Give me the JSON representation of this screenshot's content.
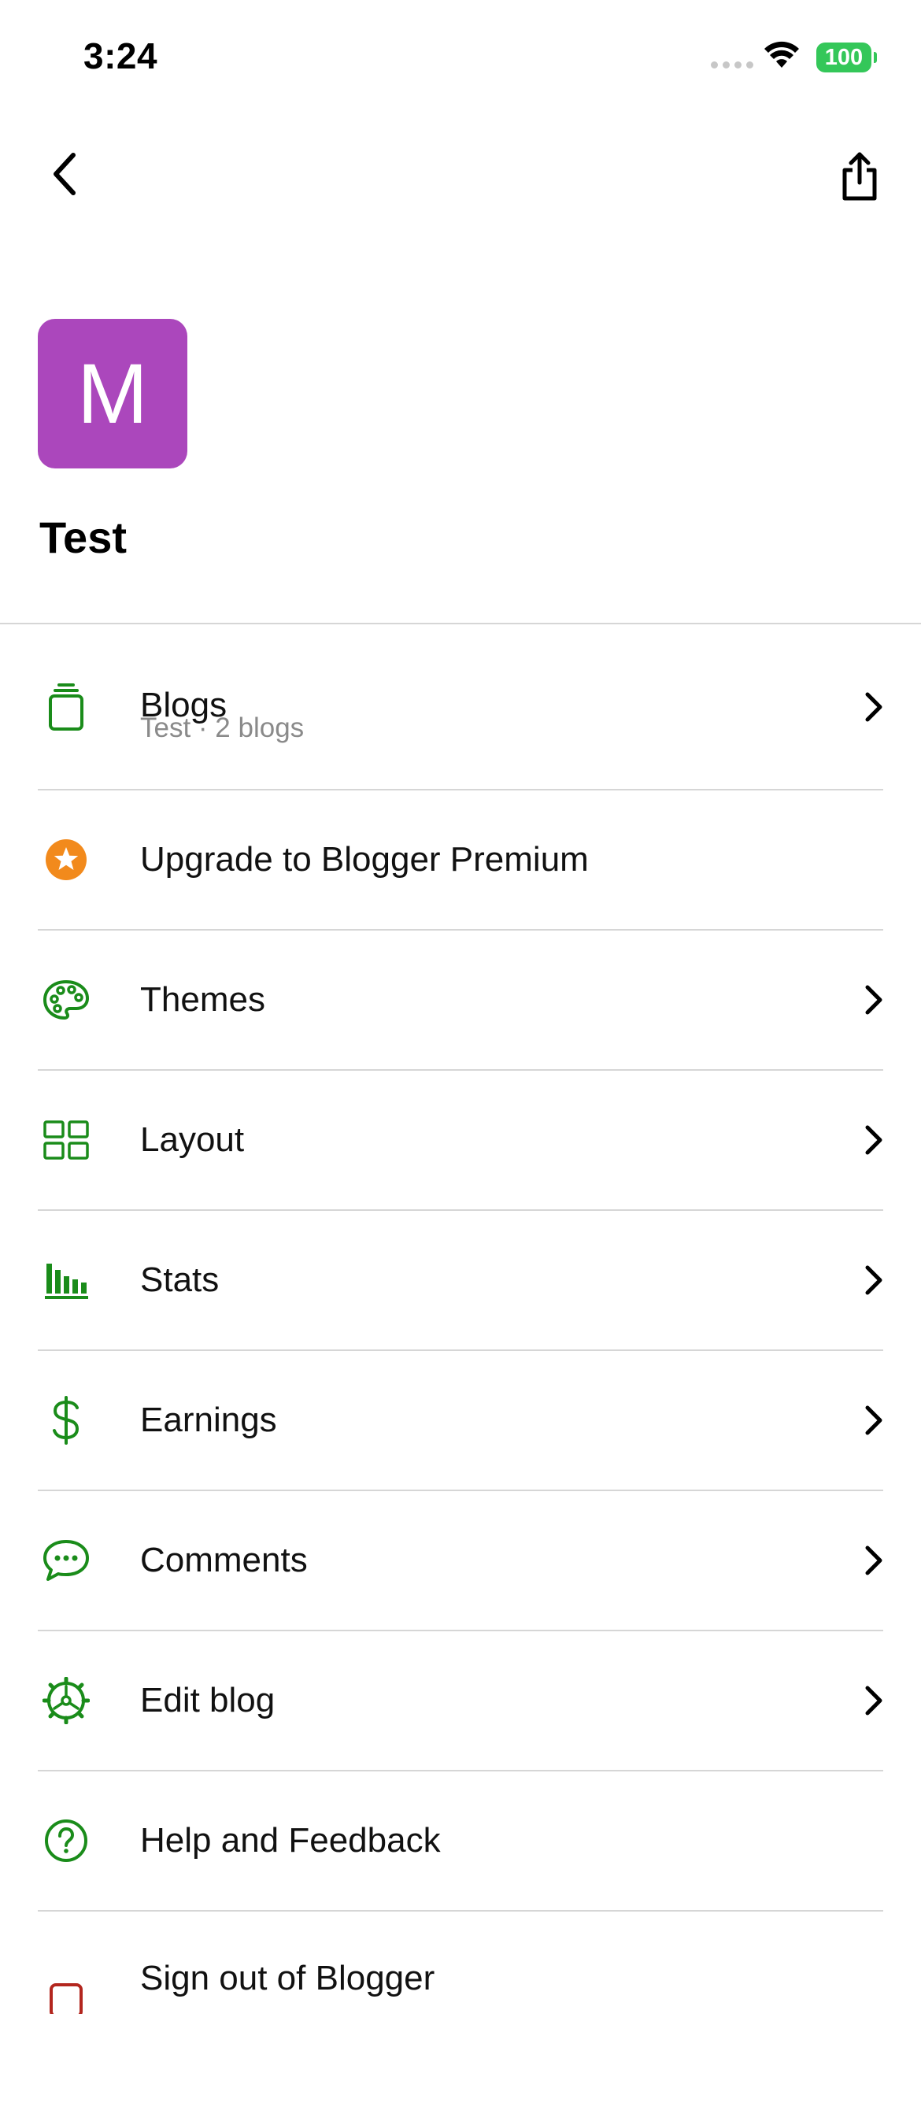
{
  "status_bar": {
    "time": "3:24",
    "battery": "100"
  },
  "header": {
    "avatar_letter": "M",
    "blog_name": "Test"
  },
  "menu": {
    "items": [
      {
        "label": "Blogs",
        "sublabel": "Test · 2 blogs",
        "icon": "blogs-icon"
      },
      {
        "label": "Upgrade to Blogger Premium",
        "icon": "premium-star-icon"
      },
      {
        "label": "Themes",
        "icon": "palette-icon"
      },
      {
        "label": "Layout",
        "icon": "layout-grid-icon"
      },
      {
        "label": "Stats",
        "icon": "stats-bar-icon"
      },
      {
        "label": "Earnings",
        "icon": "dollar-icon"
      },
      {
        "label": "Comments",
        "icon": "comment-bubble-icon"
      },
      {
        "label": "Edit blog",
        "icon": "settings-gear-icon"
      },
      {
        "label": "Help and Feedback",
        "icon": "help-icon"
      },
      {
        "label": "Sign out of Blogger",
        "icon": "sign-out-icon"
      }
    ]
  },
  "colors": {
    "accent_green": "#1a8c1a",
    "avatar_purple": "#ab47bc",
    "premium_orange": "#f28a1c",
    "signout_red": "#b3261e",
    "battery_green": "#34c759"
  }
}
